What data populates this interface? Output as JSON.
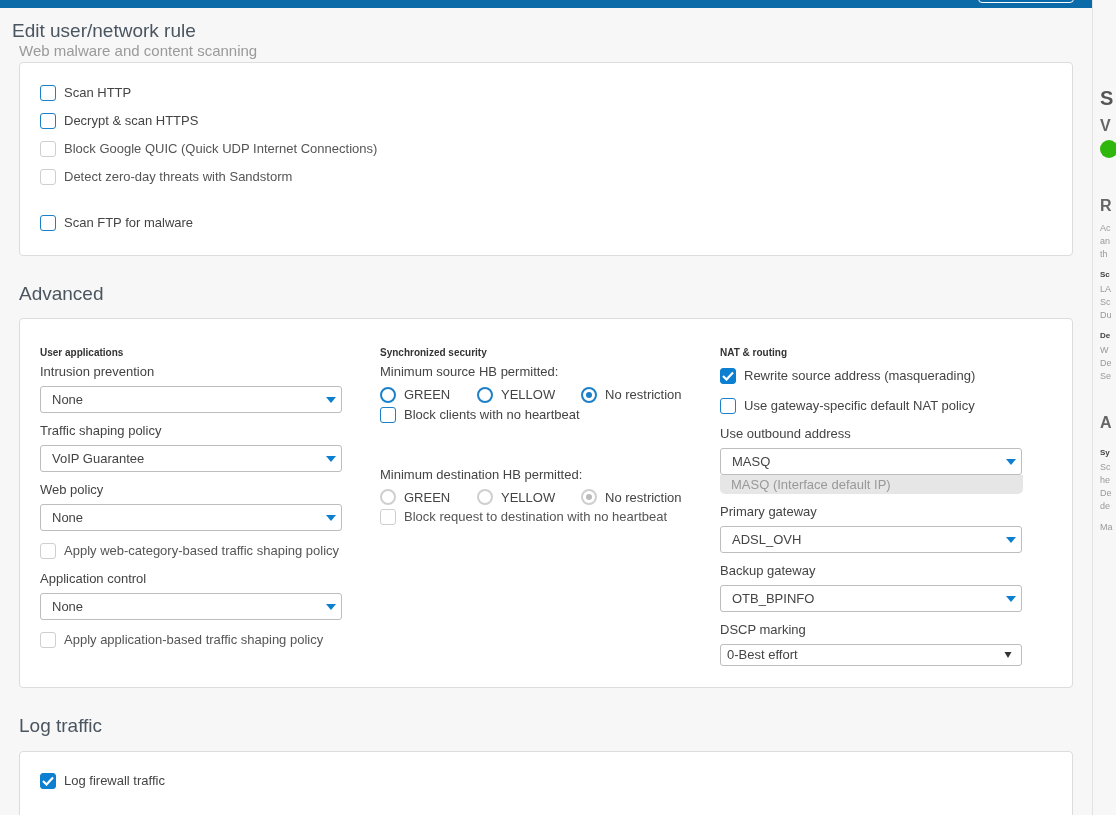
{
  "dialog": {
    "title": "Edit user/network rule",
    "faded_heading": "Web malware and content scanning"
  },
  "scanning": {
    "groups": [
      [
        {
          "label": "Scan HTTP",
          "checked": false,
          "disabled": false
        },
        {
          "label": "Decrypt & scan HTTPS",
          "checked": false,
          "disabled": false
        },
        {
          "label": "Block Google QUIC (Quick UDP Internet Connections)",
          "checked": false,
          "disabled": true
        },
        {
          "label": "Detect zero-day threats with Sandstorm",
          "checked": false,
          "disabled": true
        }
      ],
      [
        {
          "label": "Scan FTP for malware",
          "checked": false,
          "disabled": false
        }
      ]
    ]
  },
  "advanced": {
    "title": "Advanced",
    "columns": [
      [
        {
          "kind": "heading",
          "text": "User applications"
        },
        {
          "kind": "field",
          "label": "Intrusion prevention",
          "value": "None"
        },
        {
          "kind": "field",
          "label": "Traffic shaping policy",
          "value": "VoIP Guarantee"
        },
        {
          "kind": "field",
          "label": "Web policy",
          "value": "None"
        },
        {
          "kind": "checkbox",
          "label": "Apply web-category-based traffic shaping policy",
          "checked": false,
          "disabled": true
        },
        {
          "kind": "field",
          "label": "Application control",
          "value": "None"
        },
        {
          "kind": "checkbox",
          "label": "Apply application-based traffic shaping policy",
          "checked": false,
          "disabled": true
        }
      ],
      [
        {
          "kind": "heading",
          "text": "Synchronized security"
        },
        {
          "kind": "hb",
          "label": "Minimum source HB permitted:",
          "disabled": false,
          "options": [
            {
              "label": "GREEN",
              "selected": false
            },
            {
              "label": "YELLOW",
              "selected": false
            },
            {
              "label": "No restriction",
              "selected": true
            }
          ],
          "checkbox": {
            "label": "Block clients with no heartbeat",
            "checked": false
          }
        },
        {
          "kind": "hb",
          "label": "Minimum destination HB permitted:",
          "disabled": true,
          "options": [
            {
              "label": "GREEN",
              "selected": false
            },
            {
              "label": "YELLOW",
              "selected": false
            },
            {
              "label": "No restriction",
              "selected": true
            }
          ],
          "checkbox": {
            "label": "Block request to destination with no heartbeat",
            "checked": false
          }
        }
      ],
      [
        {
          "kind": "heading",
          "text": "NAT & routing"
        },
        {
          "kind": "checkbox",
          "label": "Rewrite source address (masquerading)",
          "checked": true,
          "disabled": false
        },
        {
          "kind": "checkbox",
          "label": "Use gateway-specific default NAT policy",
          "checked": false,
          "disabled": false
        },
        {
          "kind": "field",
          "label": "Use outbound address",
          "value": "MASQ",
          "hint": "MASQ (Interface default IP)"
        },
        {
          "kind": "field",
          "label": "Primary gateway",
          "value": "ADSL_OVH"
        },
        {
          "kind": "field",
          "label": "Backup gateway",
          "value": "OTB_BPINFO"
        },
        {
          "kind": "plain_field",
          "label": "DSCP marking",
          "value": "0-Best effort"
        }
      ]
    ]
  },
  "log_traffic": {
    "title": "Log traffic",
    "items": [
      {
        "label": "Log firewall traffic",
        "checked": true,
        "disabled": false
      }
    ]
  },
  "side_panel": {
    "items": [
      {
        "kind": "title",
        "text": "S"
      },
      {
        "kind": "subtitle",
        "text": "V"
      },
      {
        "kind": "status_dot"
      },
      {
        "kind": "heading",
        "text": "R"
      },
      {
        "kind": "para",
        "lines": [
          "Ac",
          "an",
          "th"
        ]
      },
      {
        "kind": "label",
        "text": "Sc"
      },
      {
        "kind": "para",
        "lines": [
          "LA",
          "Sc",
          "Du"
        ]
      },
      {
        "kind": "label",
        "text": "De"
      },
      {
        "kind": "para",
        "lines": [
          "W",
          "De",
          "Se"
        ]
      },
      {
        "kind": "heading",
        "text": "A"
      },
      {
        "kind": "label",
        "text": "Sy"
      },
      {
        "kind": "para",
        "lines": [
          "Sc",
          "he",
          "De",
          "de"
        ]
      },
      {
        "kind": "para",
        "lines": [
          "Ma"
        ]
      }
    ]
  }
}
